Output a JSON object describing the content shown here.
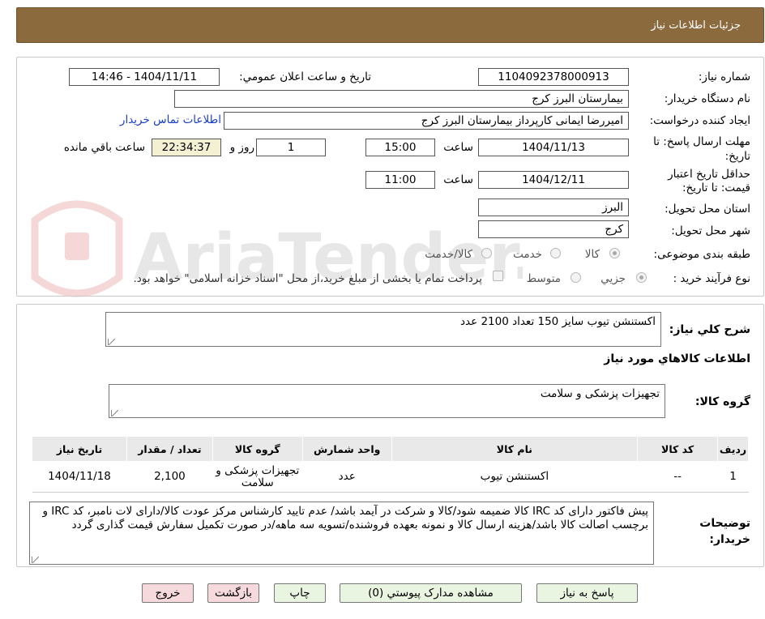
{
  "header": {
    "title": "جزئیات اطلاعات نیاز"
  },
  "watermark": {
    "text": "AriaTender.neT"
  },
  "form": {
    "need_number_label": "شماره نیاز:",
    "need_number": "1104092378000913",
    "announce_label": "تاریخ و ساعت اعلان عمومي:",
    "announce_value": "1404/11/11 - 14:46",
    "buyer_org_label": "نام دستگاه خريدار:",
    "buyer_org": "بیمارستان البرز کرج",
    "requester_label": "ايجاد کننده درخواست:",
    "requester": "امیررضا ایمانی کارپرداز بیمارستان البرز کرج",
    "contact_link": "اطلاعات تماس خريدار",
    "deadline_label_1": "مهلت ارسال پاسخ: تا",
    "deadline_label_2": "تاريخ:",
    "deadline_date": "1404/11/13",
    "time_label": "ساعت",
    "deadline_time": "15:00",
    "days_value": "1",
    "days_label": "روز و",
    "remaining_time": "22:34:37",
    "remaining_label": "ساعت باقي مانده",
    "validity_label_1": "حداقل تاريخ اعتبار",
    "validity_label_2": "قيمت: تا تاريخ:",
    "validity_date": "1404/12/11",
    "validity_time": "11:00",
    "province_label": "استان محل تحويل:",
    "province": "البرز",
    "city_label": "شهر محل تحويل:",
    "city": "کرج",
    "category_label": "طبقه بندی موضوعی:",
    "category_options": [
      "کالا",
      "خدمت",
      "کالا/خدمت"
    ],
    "category_selected": "کالا",
    "process_label": "نوع فرآيند خريد :",
    "process_options": [
      "جزيي",
      "متوسط"
    ],
    "process_selected": "جزيي",
    "treasury_note": "پرداخت تمام يا بخشی از مبلغ خريد،از محل \"اسناد خزانه اسلامی\" خواهد بود."
  },
  "summary": {
    "label": "شرح کلي نياز:",
    "text": "اکستنشن تیوب سایز 150 تعداد 2100 عدد"
  },
  "goods": {
    "section_title": "اطلاعات کالاهاي مورد نياز",
    "group_label": "گروه کالا:",
    "group_value": "تجهیزات پزشکی و سلامت",
    "columns": [
      "رديف",
      "کد کالا",
      "نام کالا",
      "واحد شمارش",
      "گروه کالا",
      "تعداد / مقدار",
      "تاريخ نياز"
    ],
    "rows": [
      {
        "index": "1",
        "code": "--",
        "name": "اکستنشن تیوب",
        "unit": "عدد",
        "group": "تجهیزات پزشکی و سلامت",
        "quantity": "2,100",
        "date": "1404/11/18"
      }
    ]
  },
  "notes": {
    "label_1": "توضيحات",
    "label_2": "خريدار:",
    "text": "پیش فاکتور دارای کد IRC کالا ضمیمه شود/کالا و شرکت در آیمد باشد/ عدم تایید کارشناس مرکز عودت کالا/دارای لات نامبر، کد IRC و برچسب اصالت کالا باشد/هزینه ارسال کالا و نمونه بعهده فروشنده/تسویه سه ماهه/در صورت تکمیل سفارش قیمت گذاری گردد"
  },
  "buttons": {
    "reply": "پاسخ به نياز",
    "view_docs": "مشاهده مدارک پيوستي (0)",
    "print": "چاپ",
    "back": "بازگشت",
    "exit": "خروج"
  },
  "colors": {
    "header_bg": "#8b6a3e",
    "button_green": "#eaf5e1",
    "button_pink": "#f6d9dd",
    "remaining_bg": "#f4f0d4",
    "link": "#1a3ec4"
  }
}
